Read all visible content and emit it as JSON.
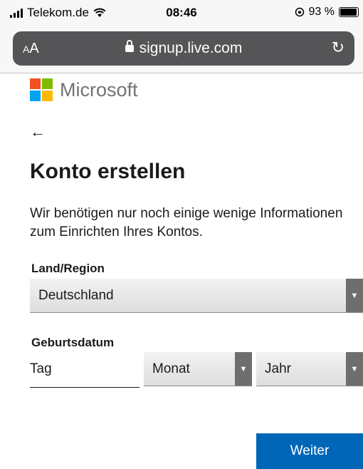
{
  "status_bar": {
    "carrier": "Telekom.de",
    "time": "08:46",
    "battery": "93 %",
    "battery_level": 0.93
  },
  "browser": {
    "text_size_button": "AA",
    "url": "signup.live.com"
  },
  "brand": {
    "name": "Microsoft",
    "colors": [
      "#f25022",
      "#7fba00",
      "#00a4ef",
      "#ffb900"
    ]
  },
  "page": {
    "back_glyph": "←",
    "title": "Konto erstellen",
    "description": "Wir benötigen nur noch einige wenige Informationen zum Einrichten Ihres Kontos.",
    "country": {
      "label": "Land/Region",
      "value": "Deutschland"
    },
    "birthdate": {
      "label": "Geburtsdatum",
      "day_placeholder": "Tag",
      "month_value": "Monat",
      "year_value": "Jahr"
    },
    "next_button": "Weiter"
  },
  "colors": {
    "accent": "#0067b8",
    "url_bar": "#555557"
  }
}
